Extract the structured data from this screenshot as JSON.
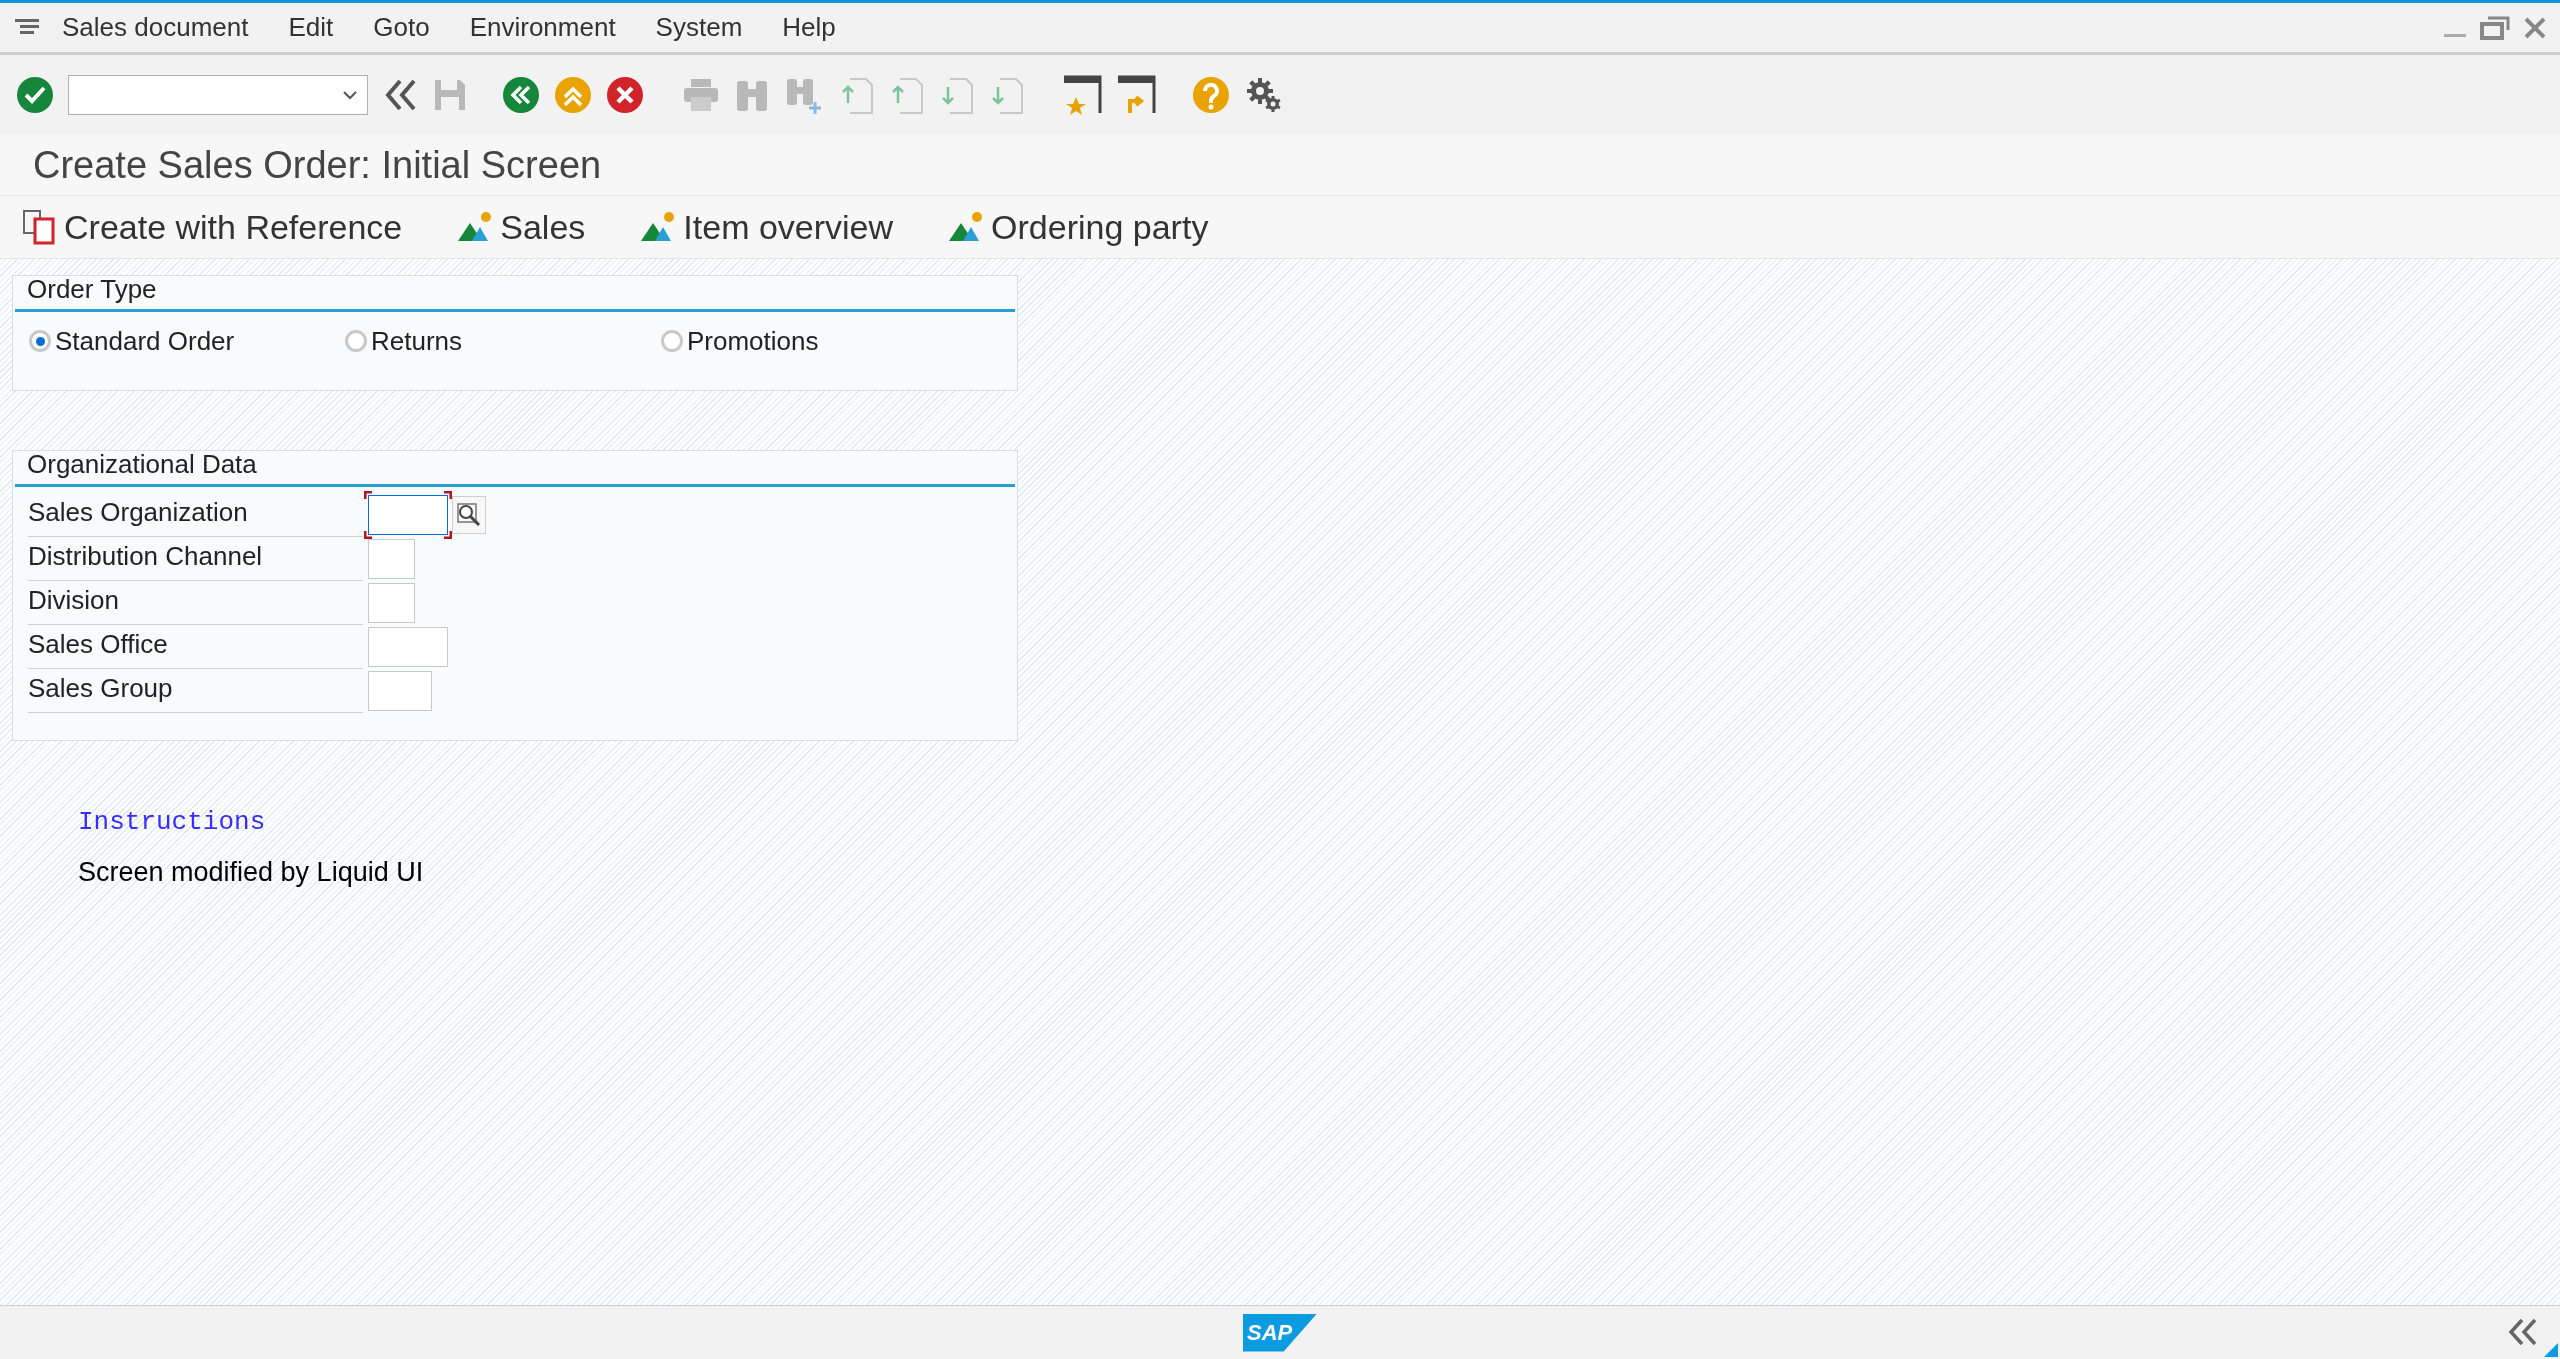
{
  "menu_bar": {
    "items": [
      "Sales document",
      "Edit",
      "Goto",
      "Environment",
      "System",
      "Help"
    ]
  },
  "title": "Create Sales Order: Initial Screen",
  "application_toolbar": [
    {
      "label": "Create with Reference",
      "kind": "reference"
    },
    {
      "label": "Sales",
      "kind": "overview"
    },
    {
      "label": "Item overview",
      "kind": "overview"
    },
    {
      "label": "Ordering party",
      "kind": "overview"
    }
  ],
  "order_type": {
    "title": "Order Type",
    "options": [
      {
        "label": "Standard Order",
        "selected": true
      },
      {
        "label": "Returns",
        "selected": false
      },
      {
        "label": "Promotions",
        "selected": false
      }
    ]
  },
  "organizational_data": {
    "title": "Organizational Data",
    "fields": [
      {
        "label": "Sales Organization",
        "focused": true,
        "search_help": true
      },
      {
        "label": "Distribution Channel",
        "focused": false,
        "search_help": false
      },
      {
        "label": "Division",
        "focused": false,
        "search_help": false
      },
      {
        "label": "Sales Office",
        "focused": false,
        "search_help": false
      },
      {
        "label": "Sales Group",
        "focused": false,
        "search_help": false
      }
    ]
  },
  "instructions": {
    "heading": "Instructions",
    "text": "Screen modified by Liquid UI"
  },
  "status_bar": {
    "logo": "SAP"
  }
}
